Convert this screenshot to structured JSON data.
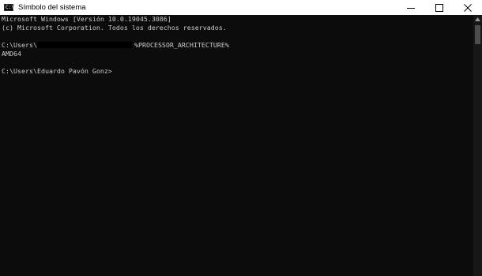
{
  "window": {
    "title": "Símbolo del sistema",
    "icon_text": "C:\\",
    "icon": "cmd-icon",
    "controls": [
      "minimize-icon",
      "maximize-icon",
      "close-icon"
    ]
  },
  "console": {
    "lines": [
      "Microsoft Windows [Versión 10.0.19045.3086]",
      "(c) Microsoft Corporation. Todos los derechos reservados.",
      "",
      "",
      "AMD64",
      "",
      "C:\\Users\\Eduardo Pavón Gonz>"
    ],
    "command_prefix": "C:\\Users\\",
    "command": "%PROCESSOR_ARCHITECTURE%"
  },
  "colors": {
    "background": "#0c0c0c",
    "text": "#cccccc",
    "titlebar": "#ffffff"
  }
}
